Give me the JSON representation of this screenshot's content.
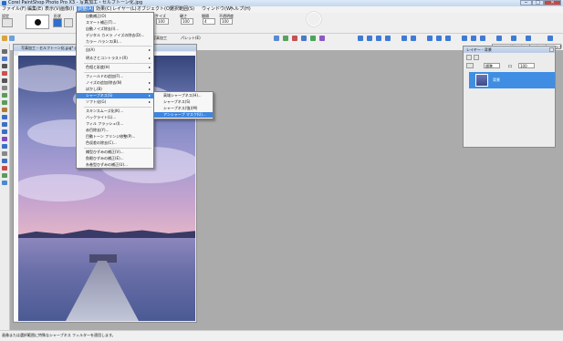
{
  "window": {
    "title": "Corel PaintShop Photo Pro X3 - 写真加工・セルフトーン化.jpg",
    "min": "─",
    "max": "□",
    "close": "✕"
  },
  "menubar": [
    "ファイル(F)",
    "編集(E)",
    "表示(V)",
    "画像(I)",
    "調整(A)",
    "効果(C)",
    "レイヤー(L)",
    "オブジェクト(O)",
    "選択範囲(S)",
    "ウィンドウ(W)",
    "ヘルプ(H)"
  ],
  "options": {
    "preset_label": "設定",
    "size_label": "形状",
    "size_label2": "サイズ",
    "hardness_label": "硬さ",
    "step_label": "間隔",
    "density_label": "不透明度",
    "val_1": "100",
    "val_2": "4",
    "val_3": "100"
  },
  "toolbar": {
    "tab1": "編集",
    "tab2": "全体",
    "tab3": "写真加工",
    "tab4": "パレット(E)"
  },
  "toolbar3": {
    "learn": "ラーニングセンター",
    "express": "エクスプレス ラボ"
  },
  "imagewin": {
    "title": "写真加工・セルフトーン化.jpg* @ 25%"
  },
  "menu": {
    "items": [
      {
        "label": "自動補正(O)"
      },
      {
        "label": "スマート補正(T)..."
      },
      {
        "label": "自動ノイズ除去(I)..."
      },
      {
        "label": "デジタル カメラ ノイズの除去(D)..."
      },
      {
        "label": "カラー バランス(B)..."
      },
      {
        "label": "明るさとコントラスト(R)",
        "sub": true
      },
      {
        "label": "色相と彩度(H)",
        "sub": true
      },
      {
        "label": "フィールドの追加(F)..."
      },
      {
        "label": "ノイズの追加/除去(N)",
        "sub": true
      },
      {
        "label": "ぼかし(B)",
        "sub": true
      },
      {
        "label": "シャープネス(S)",
        "sub": true,
        "hl": true
      },
      {
        "label": "ソフト化(G)",
        "sub": true
      },
      {
        "label": "スキンスムーズ化(K)..."
      },
      {
        "label": "バックライト(L)..."
      },
      {
        "label": "フィル フラッシュ(I)..."
      },
      {
        "label": "赤目除去(Y)..."
      },
      {
        "label": "目動トーン フリンジ修整(P)..."
      },
      {
        "label": "色収差の除去(C)..."
      },
      {
        "label": "樽型ひずみの補正(V)..."
      },
      {
        "label": "魚眼ひずみの補正(E)..."
      },
      {
        "label": "糸巻型ひずみの補正(U)..."
      }
    ],
    "dropped": "自(A)"
  },
  "submenu": {
    "items": [
      {
        "label": "高域シャープネス(H)..."
      },
      {
        "label": "シャープネス(S)"
      },
      {
        "label": "シャープネス(強)(M)"
      },
      {
        "label": "アンシャープ マスク(U)...",
        "hl": true
      }
    ]
  },
  "layers": {
    "title": "レイヤー - 背景",
    "mode": "標準",
    "opacity": "100",
    "layer_name": "背景",
    "blend_label": "ロ"
  },
  "status": "画像または選択範囲に特殊なシャープネス フィルターを適用します。",
  "colors": {
    "accent": "#3e86df",
    "menu_bg": "#f7f7f7"
  }
}
